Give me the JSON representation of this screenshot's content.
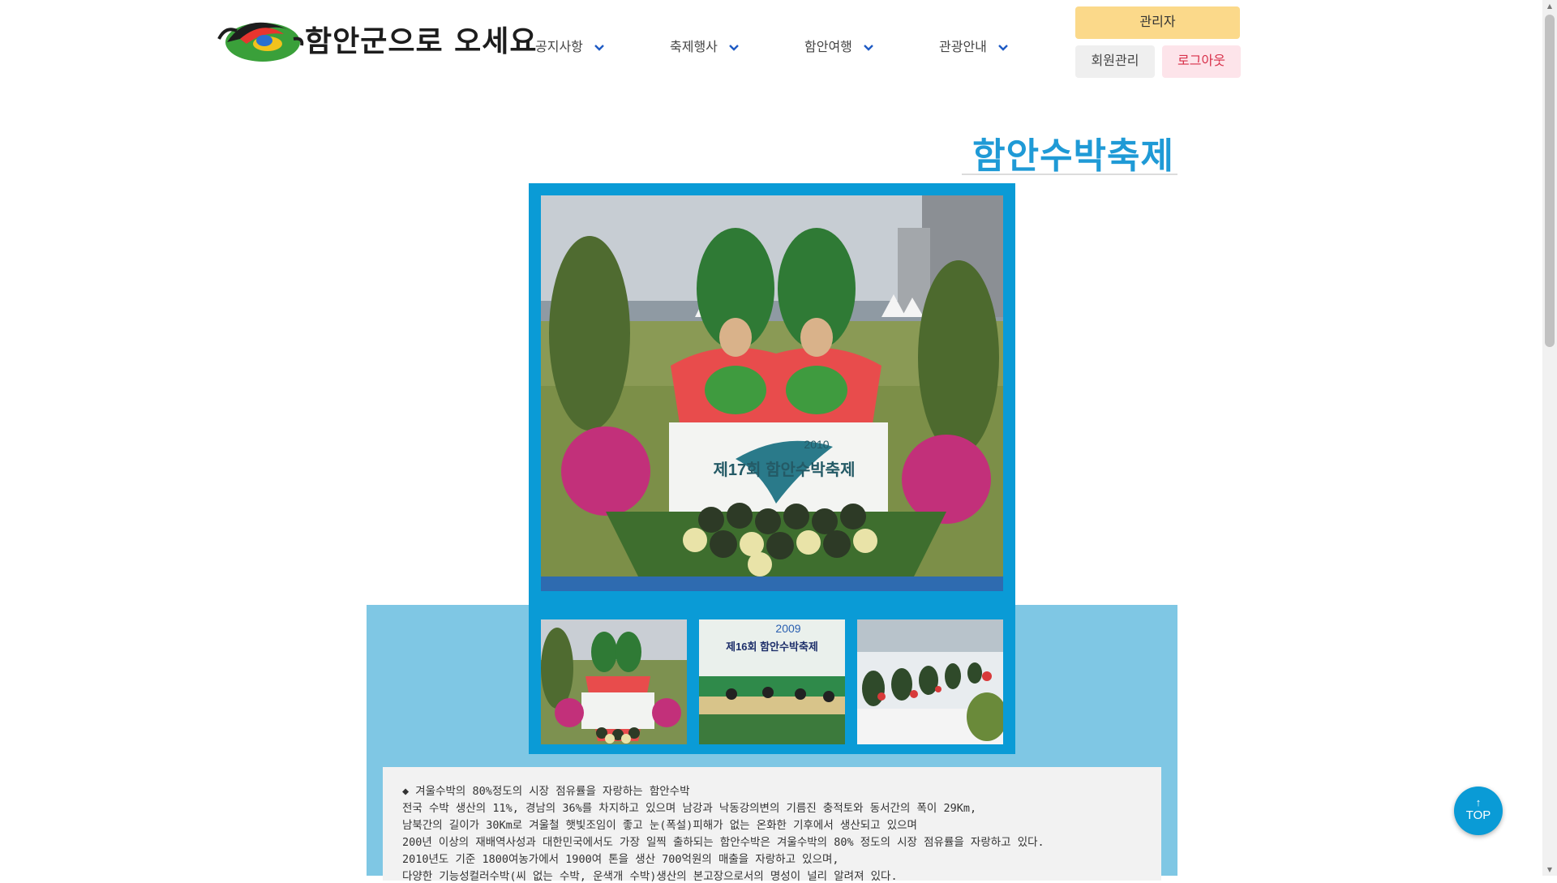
{
  "header": {
    "logo_text": "함안군으로 오세요",
    "nav": [
      {
        "label": "공지사항"
      },
      {
        "label": "축제행사"
      },
      {
        "label": "함안여행"
      },
      {
        "label": "관광안내"
      }
    ],
    "admin_label": "관리자",
    "member_label": "회원관리",
    "logout_label": "로그아웃"
  },
  "main": {
    "title": "함안수박축제",
    "banner_text": "제17회 함안수박축제",
    "banner_year": "2010",
    "thumb2_year": "2009",
    "thumb2_text": "제16회 함안수박축제",
    "description": [
      "◆ 겨울수박의 80%정도의 시장 점유률을 자랑하는 함안수박",
      "전국 수박 생산의 11%, 경남의 36%를 차지하고 있으며 남강과 낙동강의변의 기름진 충적토와 동서간의 폭이 29Km,",
      "남북간의 길이가 30Km로 겨울철 햇빛조임이 좋고 눈(폭설)피해가 없는 온화한 기후에서 생산되고 있으며",
      "200년 이상의 재배역사성과 대한민국에서도 가장 일찍 출하되는 함안수박은 겨울수박의 80% 정도의 시장 점유률을 자랑하고 있다.",
      "2010년도 기준 1800여농가에서 1900여 톤을 생산 700억원의 매출을 자랑하고 있으며,",
      "다양한 기능성컬러수박(씨 없는 수박, 운색개 수박)생산의 본고장으로서의 명성이 널리 알려져 있다."
    ]
  },
  "top_button": {
    "arrow": "↑",
    "label": "TOP"
  },
  "colors": {
    "accent": "#0a9bd6",
    "light_panel": "#7fc7e4",
    "title": "#1f9ad6",
    "admin_bg": "#fbd98a",
    "logout_text": "#d8304a"
  }
}
